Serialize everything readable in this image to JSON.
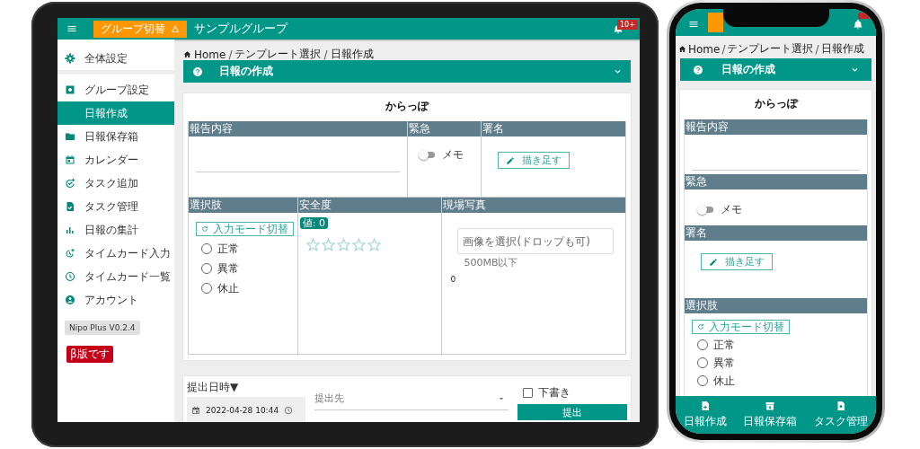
{
  "tablet": {
    "app_bar": {
      "group_button": "グループ切替",
      "group_name": "サンプルグループ",
      "badge": "10+"
    },
    "sidebar": {
      "groups": [
        {
          "items": [
            {
              "label": "全体設定",
              "selected": false
            }
          ]
        },
        {
          "items": [
            {
              "label": "グループ設定",
              "selected": false
            },
            {
              "label": "日報作成",
              "selected": true
            },
            {
              "label": "日報保存箱",
              "selected": false
            },
            {
              "label": "カレンダー",
              "selected": false
            },
            {
              "label": "タスク追加",
              "selected": false
            },
            {
              "label": "タスク管理",
              "selected": false
            },
            {
              "label": "日報の集計",
              "selected": false
            },
            {
              "label": "タイムカード入力",
              "selected": false
            },
            {
              "label": "タイムカード一覧",
              "selected": false
            },
            {
              "label": "アカウント",
              "selected": false
            }
          ]
        }
      ],
      "version": "Nipo Plus V0.2.4",
      "beta": "β版です"
    },
    "breadcrumb": [
      {
        "label": "Home"
      },
      {
        "separator": "/",
        "label": "テンプレート選択"
      },
      {
        "separator": "/",
        "label": "日報作成"
      }
    ],
    "page_title": "日報の作成",
    "form": {
      "title": "からっぽ",
      "rows": [
        {
          "sections": [
            {
              "kind": "text",
              "heading": "報告内容"
            },
            {
              "kind": "toggle",
              "heading": "緊急",
              "label": "メモ",
              "on": false
            },
            {
              "kind": "signature",
              "heading": "署名",
              "button": "描き足す"
            }
          ]
        },
        {
          "sections": [
            {
              "kind": "choice",
              "heading": "選択肢",
              "mode_button": "入力モード切替",
              "options": [
                {
                  "label": "正常",
                  "selected": false
                },
                {
                  "label": "異常",
                  "selected": false
                },
                {
                  "label": "休止",
                  "selected": false
                }
              ]
            },
            {
              "kind": "rating",
              "heading": "安全度",
              "value_chip": "値: 0",
              "stars": 0
            },
            {
              "kind": "photo",
              "heading": "現場写真",
              "placeholder": "画像を選択(ドロップも可)",
              "hint": "500MB以下",
              "count": "0"
            }
          ]
        }
      ]
    },
    "submit": {
      "date_label": "提出日時▼",
      "date_value": "2022-04-28 10:44",
      "recipient_placeholder": "提出先",
      "draft": {
        "label": "下書き",
        "checked": false
      },
      "submit_button": "提出"
    }
  },
  "phone": {
    "breadcrumb": [
      {
        "label": "Home"
      },
      {
        "separator": "/",
        "label": "テンプレート選択"
      },
      {
        "separator": "/",
        "label": "日報作成"
      }
    ],
    "page_title": "日報の作成",
    "form": {
      "title": "からっぽ",
      "sections": [
        {
          "kind": "text",
          "heading": "報告内容"
        },
        {
          "kind": "toggle",
          "heading": "緊急",
          "label": "メモ",
          "on": false
        },
        {
          "kind": "signature",
          "heading": "署名",
          "button": "描き足す"
        },
        {
          "kind": "choice",
          "heading": "選択肢",
          "mode_button": "入力モード切替",
          "options": [
            {
              "label": "正常",
              "selected": false
            },
            {
              "label": "異常",
              "selected": false
            },
            {
              "label": "休止",
              "selected": false
            }
          ]
        }
      ]
    },
    "bottom_nav": [
      {
        "label": "日報作成"
      },
      {
        "label": "日報保存箱"
      },
      {
        "label": "タスク管理"
      }
    ]
  }
}
